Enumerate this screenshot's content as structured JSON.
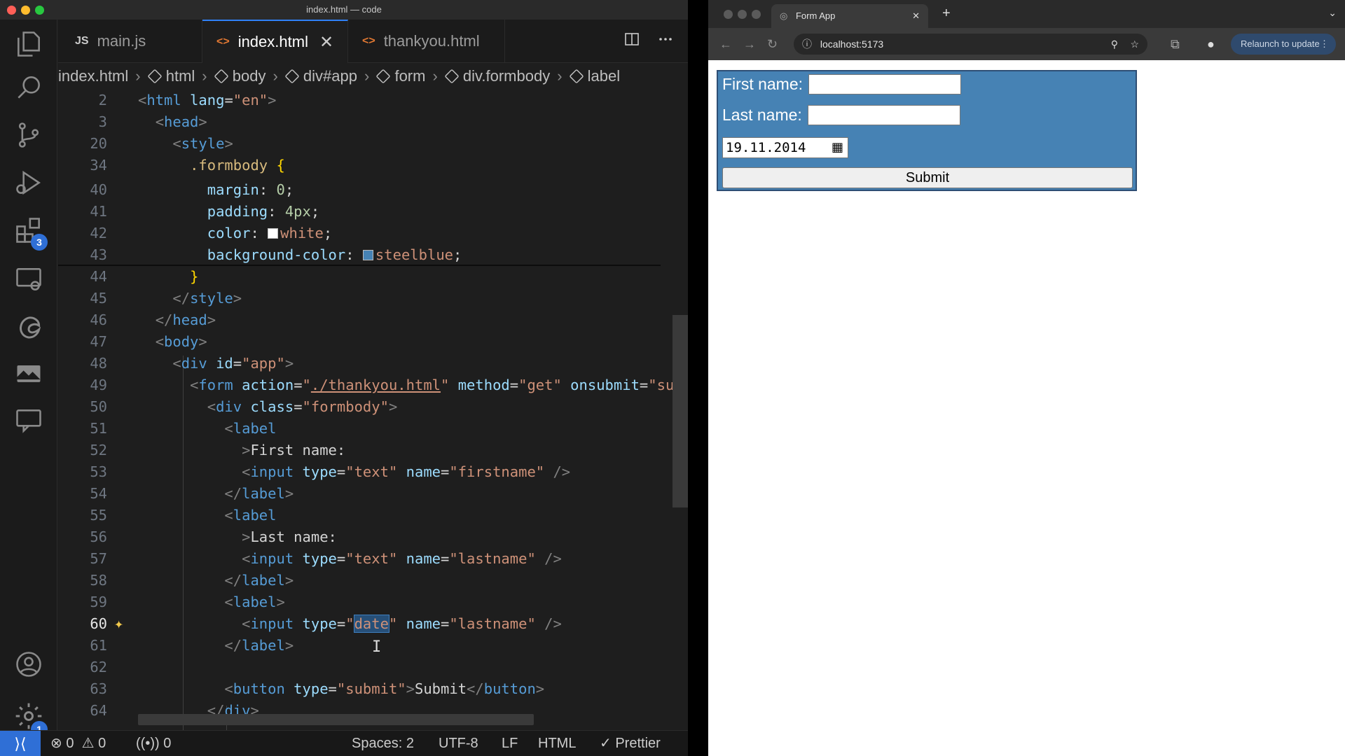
{
  "vscode": {
    "window_title": "index.html — code",
    "activity_bar": {
      "extensions_badge": "3",
      "settings_badge": "1"
    },
    "tabs": [
      {
        "icon": "JS",
        "label": "main.js"
      },
      {
        "icon": "<>",
        "label": "index.html",
        "close": "✕"
      },
      {
        "icon": "<>",
        "label": "thankyou.html"
      }
    ],
    "breadcrumb": [
      "index.html",
      "html",
      "body",
      "div#app",
      "form",
      "div.formbody",
      "label"
    ],
    "line_numbers": [
      "2",
      "3",
      "20",
      "34",
      "40",
      "41",
      "42",
      "43",
      "44",
      "45",
      "46",
      "47",
      "48",
      "49",
      "50",
      "51",
      "52",
      "53",
      "54",
      "55",
      "56",
      "57",
      "58",
      "59",
      "60",
      "61",
      "62",
      "63",
      "64"
    ],
    "status_bar": {
      "errors": "0",
      "warnings": "0",
      "ports": "0",
      "spaces": "Spaces: 2",
      "encoding": "UTF-8",
      "eol": "LF",
      "language": "HTML",
      "formatter": "Prettier"
    }
  },
  "browser": {
    "tab_title": "Form App",
    "url": "localhost:5173",
    "relaunch_label": "Relaunch to update",
    "form": {
      "first_name_label": "First name:",
      "last_name_label": "Last name:",
      "date_value": "19.11.2014",
      "submit_label": "Submit",
      "background_color": "#4682b4"
    }
  },
  "colors": {
    "editor_bg": "#1e1e1e",
    "status_remote": "#2f6fd6",
    "steelblue": "#4682b4"
  }
}
